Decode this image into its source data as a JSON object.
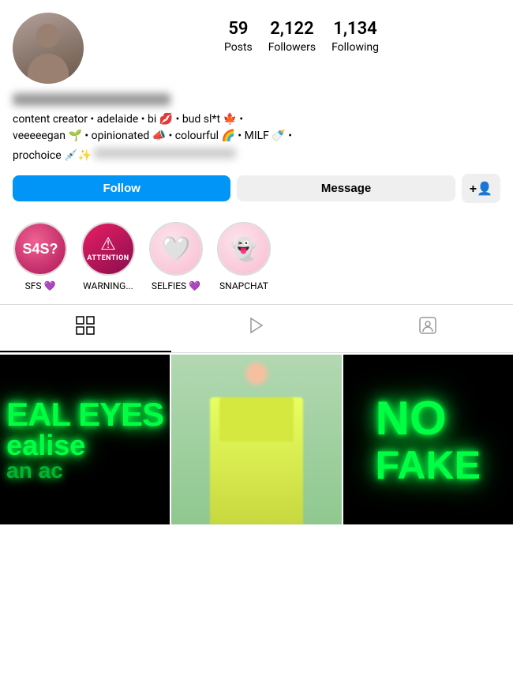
{
  "profile": {
    "stats": {
      "posts_count": "59",
      "posts_label": "Posts",
      "followers_count": "2,122",
      "followers_label": "Followers",
      "following_count": "1,134",
      "following_label": "Following"
    },
    "bio_line1": "content creator • adelaide • bi 💋 • bud sl*t 🍁 •",
    "bio_line2": "veeeeegan 🌱 • opinionated 📣 • colourful 🌈 • MILF 🍼 •",
    "bio_line3": "prochoice 💉✨"
  },
  "buttons": {
    "follow_label": "Follow",
    "message_label": "Message",
    "add_friend_icon": "person-plus"
  },
  "highlights": [
    {
      "id": "sfs",
      "label": "SFS 💜",
      "type": "sfs"
    },
    {
      "id": "warning",
      "label": "WARNING...",
      "type": "warning"
    },
    {
      "id": "selfies",
      "label": "SELFIES 💜",
      "type": "selfies"
    },
    {
      "id": "snapchat",
      "label": "SNAPCHAT",
      "type": "snap"
    }
  ],
  "tabs": {
    "grid_icon": "⊞",
    "video_icon": "▷",
    "tagged_icon": "👤"
  },
  "grid_cells": [
    {
      "id": "neon-eyes",
      "type": "neon-eyes"
    },
    {
      "id": "person",
      "type": "person"
    },
    {
      "id": "neon-fake",
      "type": "neon-fake"
    }
  ]
}
